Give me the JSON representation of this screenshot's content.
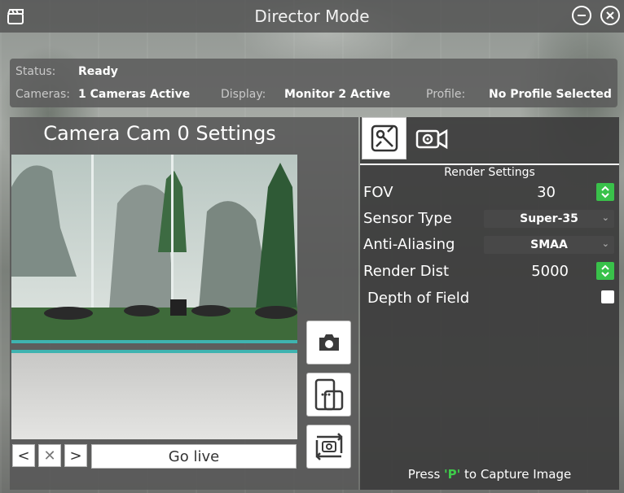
{
  "window": {
    "title": "Director Mode",
    "minimize_icon": "minus-circle-icon",
    "close_icon": "close-circle-icon",
    "app_icon": "clapperboard-icon"
  },
  "status": {
    "status_label": "Status:",
    "status_value": "Ready",
    "cameras_label": "Cameras:",
    "cameras_value": "1 Cameras Active",
    "display_label": "Display:",
    "display_value": "Monitor 2 Active",
    "profile_label": "Profile:",
    "profile_value": "No Profile Selected"
  },
  "camera_panel": {
    "title": "Camera Cam 0 Settings",
    "prev_label": "<",
    "remove_label": "✕",
    "next_label": ">",
    "go_live_label": "Go live",
    "side_buttons": [
      "camera-icon",
      "split-view-icon",
      "switch-camera-icon"
    ]
  },
  "settings_panel": {
    "tabs": [
      "render-settings-icon",
      "camera-settings-icon"
    ],
    "section_title": "Render Settings",
    "fov": {
      "label": "FOV",
      "value": "30"
    },
    "sensor_type": {
      "label": "Sensor Type",
      "value": "Super-35"
    },
    "anti_aliasing": {
      "label": "Anti-Aliasing",
      "value": "SMAA"
    },
    "render_dist": {
      "label": "Render Dist",
      "value": "5000"
    },
    "depth_of_field": {
      "label": "Depth of Field",
      "checked": false
    },
    "hint_prefix": "Press ",
    "hint_key": "'P'",
    "hint_suffix": " to Capture Image"
  },
  "colors": {
    "accent_green": "#39c14a",
    "key_green": "#3ecb4a"
  }
}
